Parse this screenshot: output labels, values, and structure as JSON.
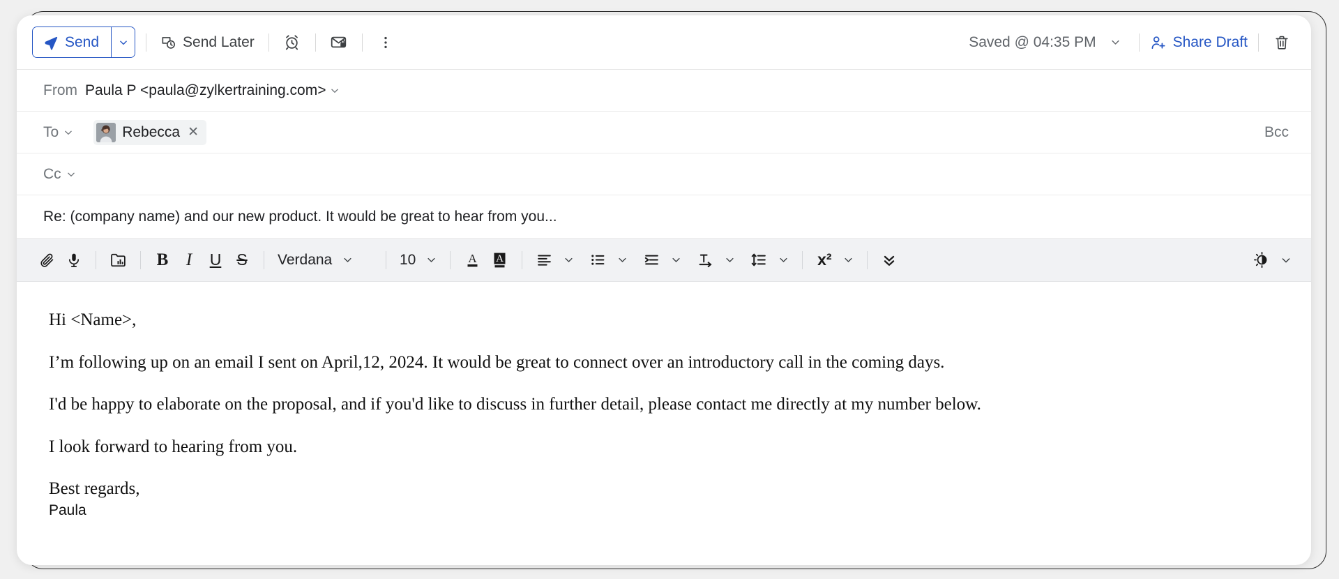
{
  "action_bar": {
    "send_label": "Send",
    "send_later_label": "Send Later",
    "saved_status": "Saved @ 04:35 PM",
    "share_draft_label": "Share Draft",
    "icons": {
      "send": "send-plane-icon",
      "send_caret": "chevron-down-icon",
      "send_later": "clock-schedule-icon",
      "reminder": "alarm-clock-icon",
      "secure": "encrypted-mail-icon",
      "more": "more-vertical-icon",
      "saved_caret": "chevron-down-icon",
      "share": "person-add-icon",
      "delete": "trash-icon"
    }
  },
  "fields": {
    "from_label": "From",
    "from_value": "Paula P <paula@zylkertraining.com>",
    "to_label": "To",
    "to_recipients": [
      {
        "name": "Rebecca",
        "avatar": "contact-photo"
      }
    ],
    "cc_label": "Cc",
    "cc_value": "",
    "bcc_label": "Bcc",
    "subject": "Re: (company name) and our new product. It would be great to hear from you..."
  },
  "format_bar": {
    "font_family": "Verdana",
    "font_size": "10",
    "tools": [
      {
        "name": "attach-icon",
        "label": "Attach"
      },
      {
        "name": "microphone-icon",
        "label": "Voice"
      },
      {
        "name": "insert-image-icon",
        "label": "Insert image"
      },
      {
        "name": "bold-icon",
        "label": "B"
      },
      {
        "name": "italic-icon",
        "label": "I"
      },
      {
        "name": "underline-icon",
        "label": "U"
      },
      {
        "name": "strikethrough-icon",
        "label": "S"
      },
      {
        "name": "text-color-icon",
        "label": "A"
      },
      {
        "name": "highlight-color-icon",
        "label": "A"
      },
      {
        "name": "align-left-icon",
        "label": "Align"
      },
      {
        "name": "bulleted-list-icon",
        "label": "List"
      },
      {
        "name": "indent-icon",
        "label": "Indent"
      },
      {
        "name": "text-direction-icon",
        "label": "Direction"
      },
      {
        "name": "line-spacing-icon",
        "label": "Line spacing"
      },
      {
        "name": "superscript-icon",
        "label": "x²"
      },
      {
        "name": "more-options-icon",
        "label": "More"
      },
      {
        "name": "theme-brightness-icon",
        "label": "Theme"
      }
    ]
  },
  "body": {
    "paragraphs": [
      "Hi <Name>,",
      "I’m following up on an email I sent on April,12, 2024. It would be great to connect over an introductory call in the coming days.",
      "I'd be happy to elaborate on the proposal, and if you'd like to discuss in further detail, please contact me directly at my number below.",
      "I look forward to hearing from you."
    ],
    "signoff": "Best regards,",
    "signature_name": "Paula"
  },
  "colors": {
    "accent": "#2556c4",
    "toolbar_bg": "#f1f2f4",
    "page_bg": "#f0f0f0",
    "text": "#202124",
    "muted_text": "#70757a"
  }
}
